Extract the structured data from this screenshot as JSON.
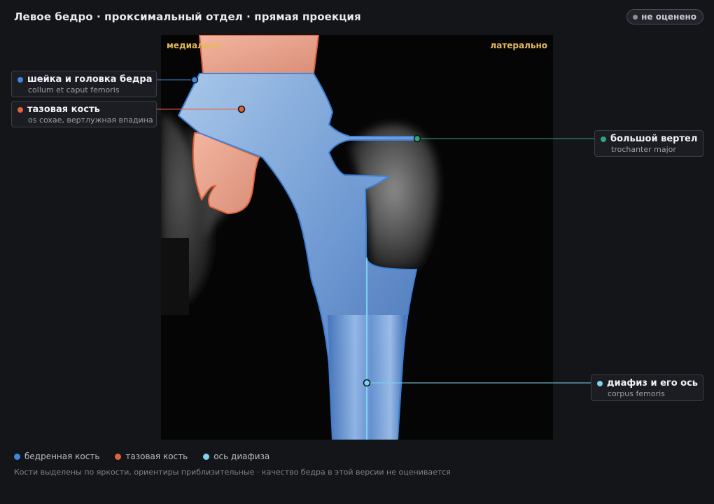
{
  "header": {
    "title": "Левое бедро · проксимальный отдел · прямая проекция",
    "status_badge": "не оценено"
  },
  "viewer": {
    "orientation_left": "медиально",
    "orientation_right": "латерально"
  },
  "labels": {
    "femoral_neck": {
      "name": "шейка и головка бедра",
      "latin": "collum et caput femoris"
    },
    "pelvic_bone": {
      "name": "тазовая кость",
      "latin": "os coxae, вертлужная впадина"
    },
    "trochanter": {
      "name": "большой вертел",
      "latin": "trochanter major"
    },
    "shaft": {
      "name": "диафиз и его ось",
      "latin": "corpus femoris"
    }
  },
  "legend": [
    {
      "label": "бедренная кость",
      "color": "#3f86e0"
    },
    {
      "label": "тазовая кость",
      "color": "#e0643a"
    },
    {
      "label": "ось диафиза",
      "color": "#7fd2f0"
    }
  ],
  "footnote": "Кости выделены по яркости, ориентиры приблизительные · качество бедра в этой версии не оценивается",
  "colors": {
    "femur": "#3f86e0",
    "pelvis": "#e0643a",
    "trochanter": "#2fa57f",
    "axis": "#7fd2f0",
    "orientation": "#e5b95a"
  },
  "icons": {
    "status": "status-dot-icon",
    "label_marker": "dot-icon"
  }
}
